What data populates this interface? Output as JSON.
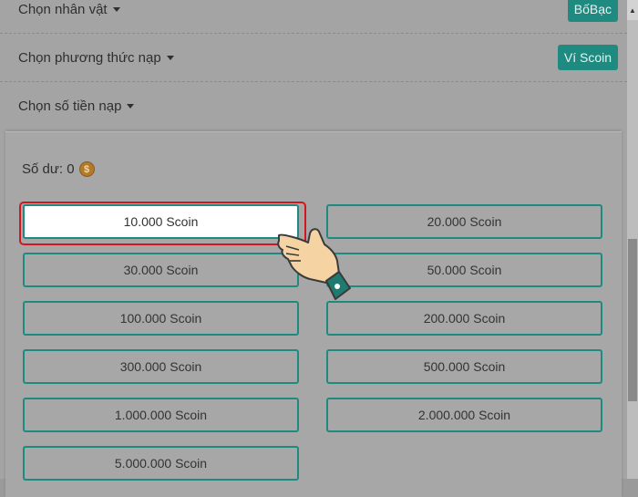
{
  "rows": [
    {
      "label": "Chọn nhân vật",
      "tag": "BốBạc"
    },
    {
      "label": "Chọn phương thức nạp",
      "tag": "Ví Scoin"
    },
    {
      "label": "Chọn số tiền nạp",
      "tag": ""
    }
  ],
  "balance": {
    "label": "Số dư: 0",
    "coin_symbol": "$"
  },
  "options": [
    "10.000 Scoin",
    "20.000 Scoin",
    "30.000 Scoin",
    "50.000 Scoin",
    "100.000 Scoin",
    "200.000 Scoin",
    "300.000 Scoin",
    "500.000 Scoin",
    "1.000.000 Scoin",
    "2.000.000 Scoin",
    "5.000.000 Scoin"
  ],
  "selected_option": "10.000 Scoin",
  "colors": {
    "accent": "#1f8a80",
    "highlight": "#d0171f",
    "coin": "#b27a2a"
  },
  "icons": {
    "pointer": "hand-pointer-icon",
    "coin": "coin-icon",
    "caret": "caret-down-icon"
  }
}
